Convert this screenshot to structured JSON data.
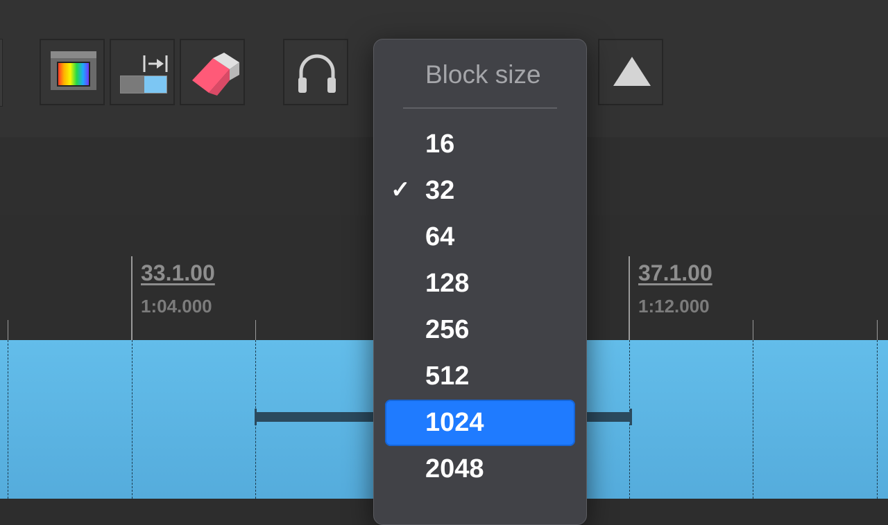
{
  "toolbar": {
    "buttons": [
      {
        "name": "spectrum-view-button",
        "icon": "spectrum-icon"
      },
      {
        "name": "align-right-button",
        "icon": "align-to-end-icon"
      },
      {
        "name": "eraser-button",
        "icon": "eraser-icon"
      },
      {
        "name": "headphones-button",
        "icon": "headphones-icon"
      },
      {
        "name": "triangle-button",
        "icon": "triangle-up-icon"
      }
    ]
  },
  "ruler": {
    "markers": [
      {
        "bar": "33.1.00",
        "time": "1:04.000"
      },
      {
        "bar": "37.1.00",
        "time": "1:12.000"
      }
    ]
  },
  "dropdown": {
    "header": "Block size",
    "checkmark": "✓",
    "options": [
      "16",
      "32",
      "64",
      "128",
      "256",
      "512",
      "1024",
      "2048"
    ],
    "checked": "32",
    "highlighted": "1024"
  },
  "colors": {
    "region": "#5eb6e4",
    "highlight": "#1f7bff",
    "menu_bg": "#414247"
  }
}
